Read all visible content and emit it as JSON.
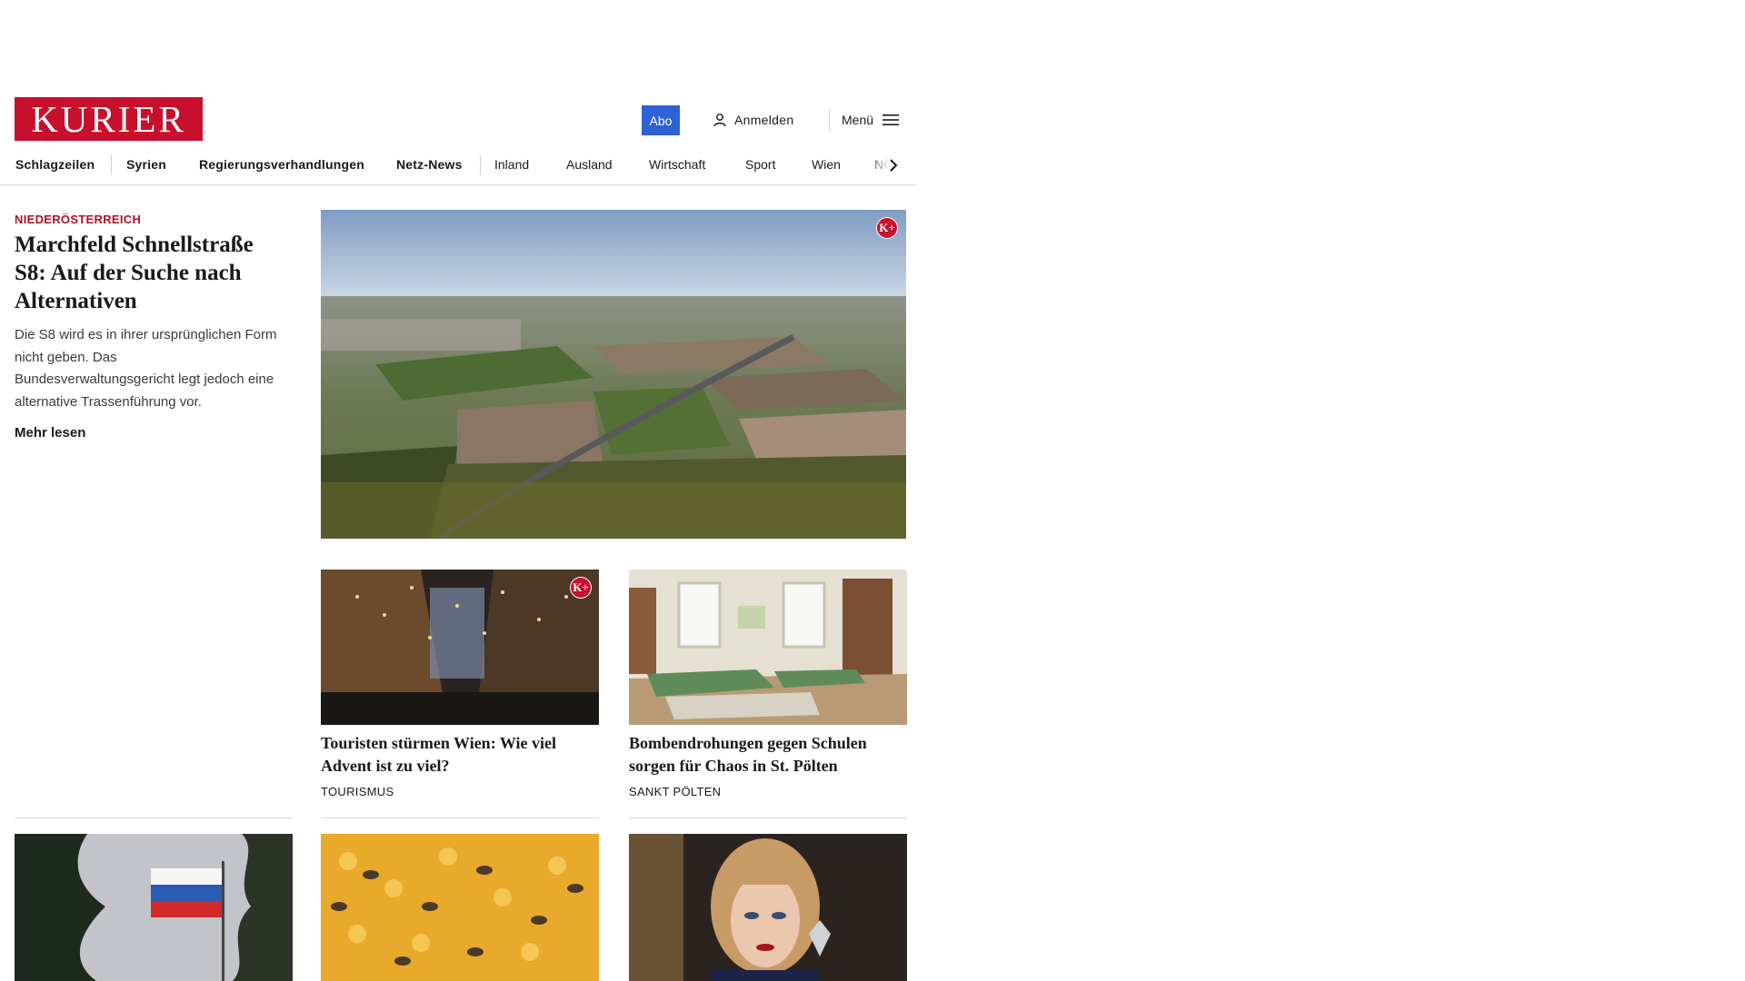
{
  "header": {
    "logo_text": "KURIER",
    "abo_label": "Abo",
    "login_label": "Anmelden",
    "menu_label": "Menü",
    "brand_color": "#c8102e",
    "abo_color": "#2e62d4"
  },
  "nav": {
    "items": [
      {
        "label": "Schlagzeilen"
      },
      {
        "label": "Syrien"
      },
      {
        "label": "Regierungsverhandlungen"
      },
      {
        "label": "Netz-News"
      },
      {
        "label": "Inland"
      },
      {
        "label": "Ausland"
      },
      {
        "label": "Wirtschaft"
      },
      {
        "label": "Sport"
      },
      {
        "label": "Wien"
      },
      {
        "label": "NÖ"
      }
    ]
  },
  "lead": {
    "kicker": "NIEDERÖSTERREICH",
    "title": "Marchfeld Schnellstraße S8: Auf der Suche nach Alternativen",
    "teaser": "Die S8 wird es in ihrer ursprünglichen Form nicht geben. Das Bundesverwaltungsgericht legt jedoch eine alternative Trassenführung vor.",
    "more_label": "Mehr lesen",
    "premium_badge": "K+"
  },
  "cards": [
    {
      "title": "Touristen stürmen Wien: Wie viel Advent ist zu viel?",
      "kicker": "TOURISMUS",
      "premium_badge": "K+"
    },
    {
      "title": "Bombendrohungen gegen Schulen sorgen für Chaos in St. Pölten",
      "kicker": "SANKT PÖLTEN"
    }
  ]
}
